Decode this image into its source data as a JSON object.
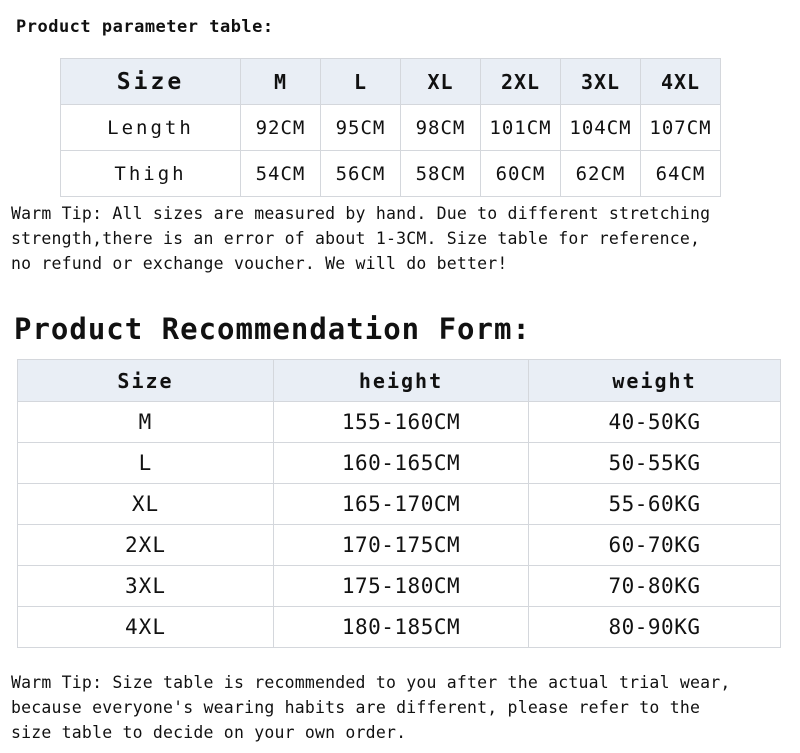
{
  "page": {
    "background": "#ffffff",
    "text_color": "#111111",
    "header_fill": "#e9eef5",
    "border_color": "#d4d7dc"
  },
  "parameter_section": {
    "title": "Product parameter table:",
    "table": {
      "header": [
        "Size",
        "M",
        "L",
        "XL",
        "2XL",
        "3XL",
        "4XL"
      ],
      "rows": [
        {
          "label": "Length",
          "values": [
            "92CM",
            "95CM",
            "98CM",
            "101CM",
            "104CM",
            "107CM"
          ]
        },
        {
          "label": "Thigh",
          "values": [
            "54CM",
            "56CM",
            "58CM",
            "60CM",
            "62CM",
            "64CM"
          ]
        }
      ]
    },
    "warm_tip": "Warm Tip: All sizes are measured by hand. Due to different stretching\nstrength,there is an error of about 1-3CM. Size table for reference,\nno refund or exchange voucher. We will do better!"
  },
  "recommendation_section": {
    "title": "Product Recommendation Form:",
    "table": {
      "header": [
        "Size",
        "height",
        "weight"
      ],
      "rows": [
        {
          "size": "M",
          "height": "155-160CM",
          "weight": "40-50KG"
        },
        {
          "size": "L",
          "height": "160-165CM",
          "weight": "50-55KG"
        },
        {
          "size": "XL",
          "height": "165-170CM",
          "weight": "55-60KG"
        },
        {
          "size": "2XL",
          "height": "170-175CM",
          "weight": "60-70KG"
        },
        {
          "size": "3XL",
          "height": "175-180CM",
          "weight": "70-80KG"
        },
        {
          "size": "4XL",
          "height": "180-185CM",
          "weight": "80-90KG"
        }
      ]
    },
    "warm_tip": "Warm Tip: Size table is recommended to you after the actual trial wear,\n because everyone's wearing habits are different, please refer to the\nsize table to decide on your own order."
  }
}
